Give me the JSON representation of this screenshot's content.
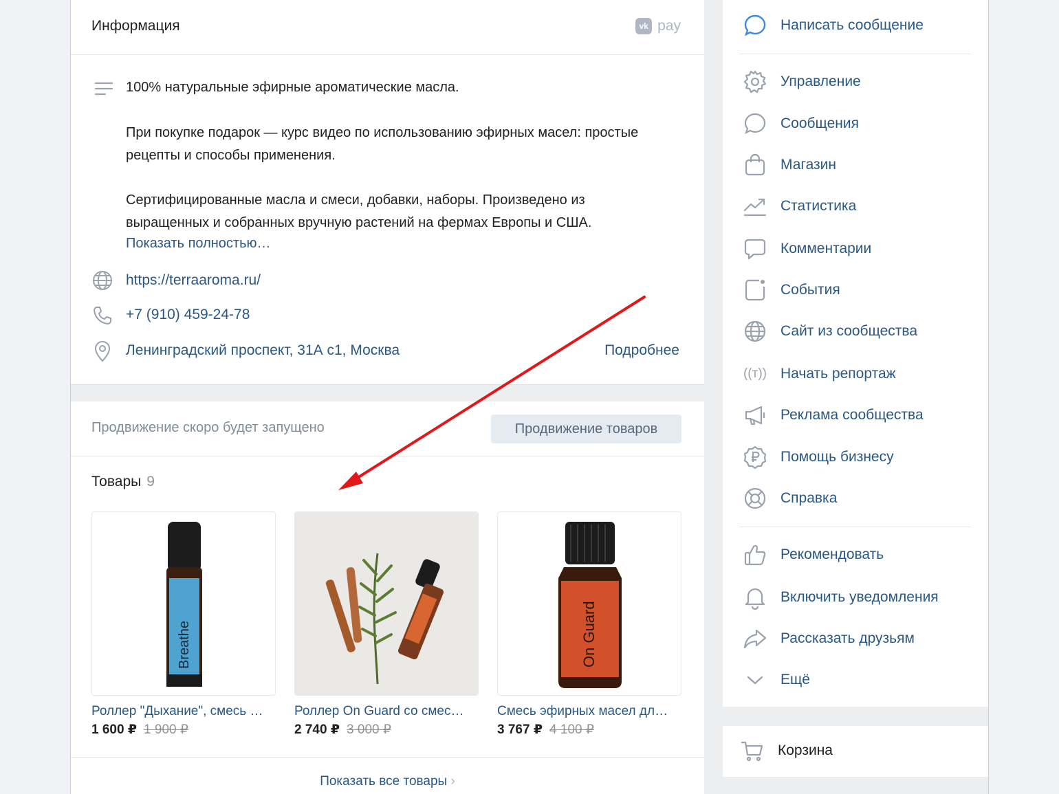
{
  "info": {
    "title": "Информация",
    "vkpay_logo": "vk",
    "vkpay_label": "pay",
    "paragraphs": [
      "100% натуральные эфирные ароматические масла.",
      "При покупке подарок — курс видео по использованию эфирных масел: простые рецепты и способы применения.",
      "Сертифицированные масла и смеси, добавки, наборы. Произведено из выращенных и собранных вручную растений на фермах Европы и США."
    ],
    "show_more": "Показать полностью…",
    "website": "https://terraaroma.ru/",
    "phone": "+7 (910) 459-24-78",
    "address": "Ленинградский проспект, 31А с1, Москва",
    "details_link": "Подробнее"
  },
  "goods": {
    "promo_text": "Продвижение скоро будет запущено",
    "promo_button": "Продвижение товаров",
    "title": "Товары",
    "count": "9",
    "items": [
      {
        "name": "Роллер \"Дыхание\", смесь …",
        "price": "1 600 ₽",
        "old_price": "1 900 ₽",
        "label": "Breathe"
      },
      {
        "name": "Роллер On Guard со смес…",
        "price": "2 740 ₽",
        "old_price": "3 000 ₽"
      },
      {
        "name": "Смесь эфирных масел дл…",
        "price": "3 767 ₽",
        "old_price": "4 100 ₽",
        "label": "On Guard"
      }
    ],
    "show_all": "Показать все товары"
  },
  "sidebar": {
    "write_message": "Написать сообщение",
    "items": [
      {
        "label": "Управление",
        "icon": "gear-icon"
      },
      {
        "label": "Сообщения",
        "icon": "chat-bubble-icon"
      },
      {
        "label": "Магазин",
        "icon": "shopping-bag-icon"
      },
      {
        "label": "Статистика",
        "icon": "chart-icon"
      },
      {
        "label": "Комментарии",
        "icon": "comment-icon"
      },
      {
        "label": "События",
        "icon": "event-icon"
      },
      {
        "label": "Сайт из сообщества",
        "icon": "globe-icon"
      },
      {
        "label": "Начать репортаж",
        "icon": "broadcast-icon"
      },
      {
        "label": "Реклама сообщества",
        "icon": "megaphone-icon"
      },
      {
        "label": "Помощь бизнесу",
        "icon": "ruble-icon"
      },
      {
        "label": "Справка",
        "icon": "lifebuoy-icon"
      }
    ],
    "items2": [
      {
        "label": "Рекомендовать",
        "icon": "thumbs-up-icon"
      },
      {
        "label": "Включить уведомления",
        "icon": "bell-icon"
      },
      {
        "label": "Рассказать друзьям",
        "icon": "share-icon"
      },
      {
        "label": "Ещё",
        "icon": "chevron-down-icon"
      }
    ],
    "broadcast_glyph": "((т))"
  },
  "cart": {
    "label": "Корзина"
  },
  "colors": {
    "link": "#2a5885",
    "icon": "#99a2ad",
    "arrow": "#e0181b"
  }
}
